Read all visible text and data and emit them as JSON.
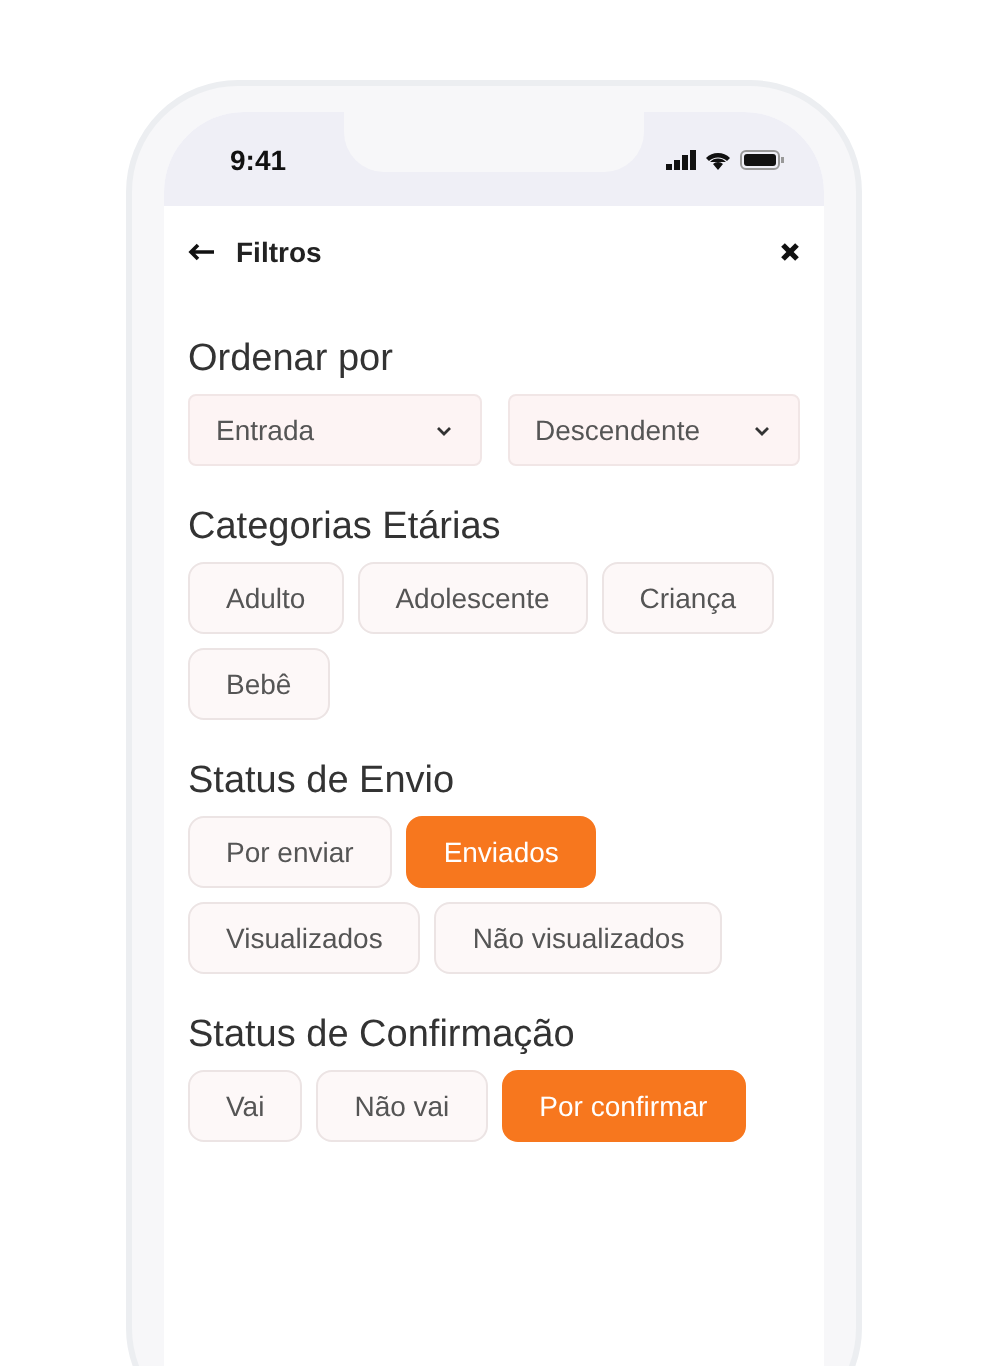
{
  "status_bar": {
    "time": "9:41"
  },
  "header": {
    "title": "Filtros"
  },
  "sort": {
    "heading": "Ordenar por",
    "dropdowns": [
      {
        "value": "Entrada"
      },
      {
        "value": "Descendente"
      }
    ]
  },
  "groups": [
    {
      "heading": "Categorias Etárias",
      "options": [
        {
          "label": "Adulto",
          "selected": false
        },
        {
          "label": "Adolescente",
          "selected": false
        },
        {
          "label": "Criança",
          "selected": false
        },
        {
          "label": "Bebê",
          "selected": false
        }
      ]
    },
    {
      "heading": "Status de Envio",
      "options": [
        {
          "label": "Por enviar",
          "selected": false
        },
        {
          "label": "Enviados",
          "selected": true
        },
        {
          "label": "Visualizados",
          "selected": false
        },
        {
          "label": "Não visualizados",
          "selected": false
        }
      ]
    },
    {
      "heading": "Status de Confirmação",
      "options": [
        {
          "label": "Vai",
          "selected": false
        },
        {
          "label": "Não vai",
          "selected": false
        },
        {
          "label": "Por confirmar",
          "selected": true
        }
      ]
    }
  ]
}
